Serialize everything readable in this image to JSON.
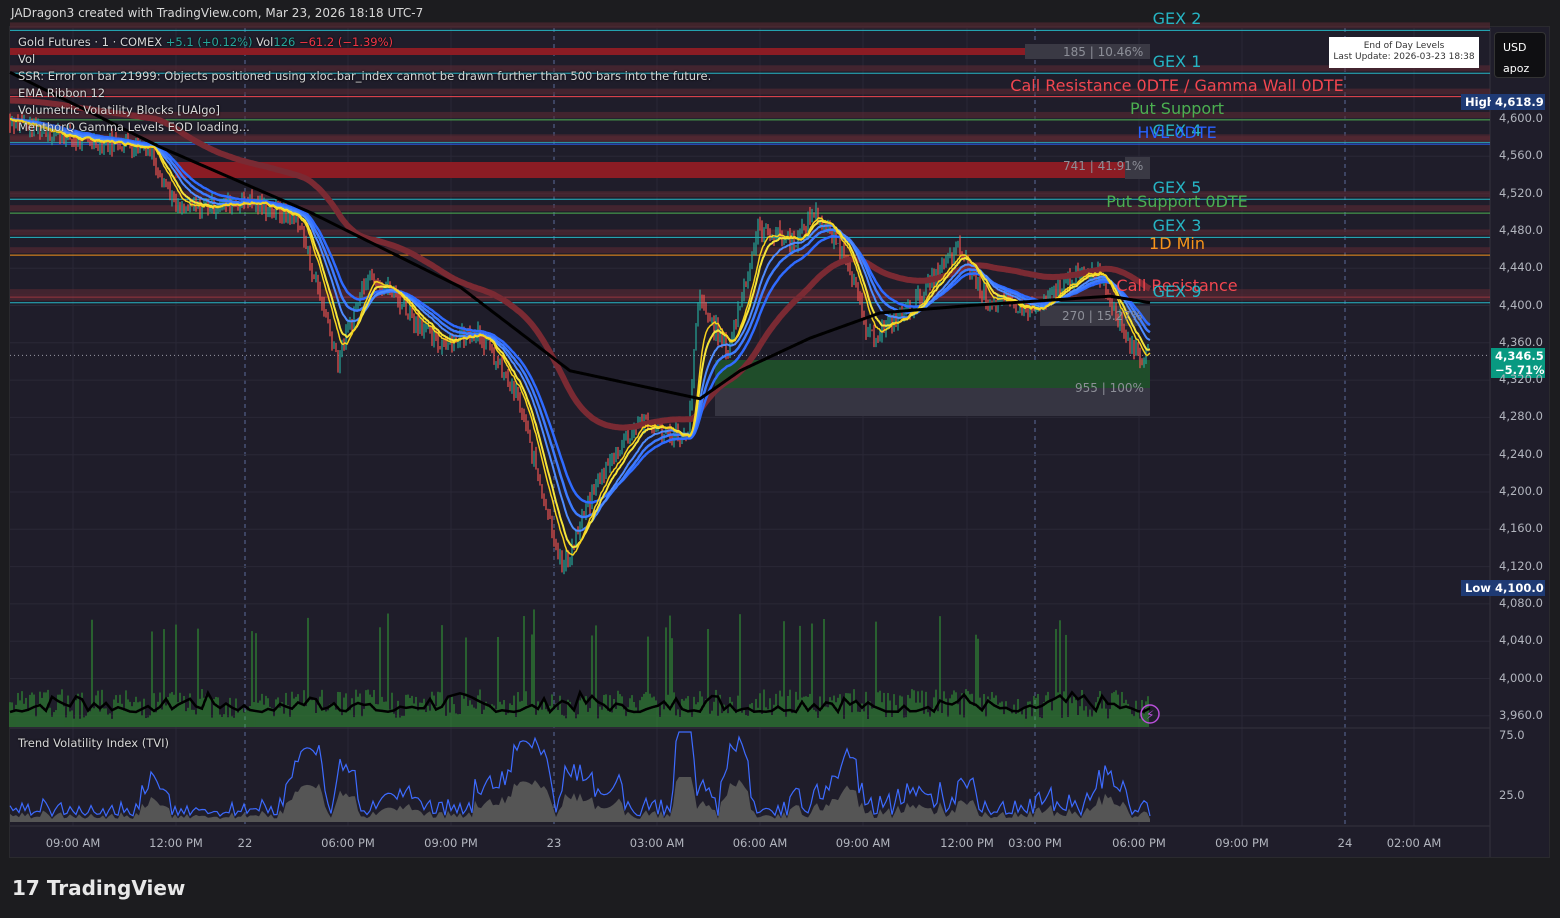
{
  "header": {
    "attribution": "JADragon3 created with TradingView.com, Mar 23, 2026 18:18 UTC-7"
  },
  "legend": {
    "symbol": "Gold Futures · 1 · COMEX",
    "change": "+5.1 (+0.12%)",
    "vol_label": "Vol",
    "vol_value": "126",
    "vol_change": "−61.2 (−1.39%)",
    "items": [
      "Vol",
      "SSR: Error on bar 21999: Objects positioned using xloc.bar_index cannot be drawn further than 500 bars into the future.",
      "EMA Ribbon 12",
      "Volumetric Volatility Blocks [UAlgo]",
      "MenthorQ Gamma Levels EOD loading..."
    ]
  },
  "eod_box": {
    "title": "End of Day Levels",
    "updated": "Last Update: 2026-03-23 18:38"
  },
  "currency": {
    "currency": "USD",
    "user": "apoz"
  },
  "price_axis": {
    "ticks": [
      4600,
      4560,
      4520,
      4480,
      4440,
      4400,
      4360,
      4320,
      4280,
      4240,
      4200,
      4160,
      4120,
      4080,
      4040,
      4000,
      3960
    ],
    "labels": [
      "4,600.0",
      "4,560.0",
      "4,520.0",
      "4,480.0",
      "4,440.0",
      "4,400.0",
      "4,360.0",
      "4,320.0",
      "4,280.0",
      "4,240.0",
      "4,200.0",
      "4,160.0",
      "4,120.0",
      "4,080.0",
      "4,040.0",
      "4,000.0",
      "3,960.0"
    ],
    "high_label": "High",
    "high_value": "4,618.9",
    "low_label": "Low",
    "low_value": "4,100.0",
    "last_price": "4,346.5",
    "last_change": "−5.71%"
  },
  "tvi": {
    "title": "Trend Volatility Index (TVI)",
    "ticks": [
      "75.0",
      "25.0"
    ]
  },
  "time_axis": [
    "09:00 AM",
    "12:00 PM",
    "22",
    "06:00 PM",
    "09:00 PM",
    "23",
    "03:00 AM",
    "06:00 AM",
    "09:00 AM",
    "12:00 PM",
    "03:00 PM",
    "06:00 PM",
    "09:00 PM",
    "24",
    "02:00 AM"
  ],
  "levels": [
    {
      "label": "GEX 2",
      "price": 4695,
      "color": "#26b5c4"
    },
    {
      "label": "GEX 1",
      "price": 4649,
      "color": "#26b5c4"
    },
    {
      "label": "Call Resistance 0DTE / Gamma Wall 0DTE",
      "price": 4624,
      "color": "#f2464f"
    },
    {
      "label": "Put Support",
      "price": 4599,
      "color": "#4caf50"
    },
    {
      "label": "GEX 4",
      "price": 4575,
      "color": "#26b5c4"
    },
    {
      "label": "HVL 0DTE",
      "price": 4573,
      "color": "#2962ff"
    },
    {
      "label": "GEX 5",
      "price": 4514,
      "color": "#26b5c4"
    },
    {
      "label": "Put Support 0DTE",
      "price": 4499,
      "color": "#4caf50"
    },
    {
      "label": "GEX 3",
      "price": 4473,
      "color": "#26b5c4"
    },
    {
      "label": "1D Min",
      "price": 4454,
      "color": "#f7931a"
    },
    {
      "label": "Call Resistance",
      "price": 4409,
      "color": "#f2464f"
    },
    {
      "label": "GEX 9",
      "price": 4403,
      "color": "#26b5c4"
    }
  ],
  "blocks": [
    {
      "label": "185 | 10.46%"
    },
    {
      "label": "741 | 41.91%"
    },
    {
      "label": "270 | 15.27%"
    },
    {
      "label": "955 | 100%"
    }
  ],
  "chart_data": {
    "type": "line",
    "title": "Gold Futures · 1 · COMEX",
    "ylim": [
      3950,
      4700
    ],
    "price_path": {
      "bar": [
        0,
        70,
        140,
        170,
        240,
        290,
        330,
        360,
        390,
        430,
        470,
        510,
        555,
        590,
        630,
        680,
        690,
        720,
        750,
        790,
        805,
        840,
        860,
        900,
        950,
        980,
        1030,
        1060,
        1090,
        1120,
        1135,
        1140
      ],
      "price": [
        4600,
        4577,
        4572,
        4502,
        4513,
        4492,
        4342,
        4438,
        4406,
        4358,
        4374,
        4299,
        4116,
        4213,
        4277,
        4256,
        4406,
        4352,
        4481,
        4470,
        4502,
        4449,
        4363,
        4395,
        4460,
        4406,
        4395,
        4427,
        4438,
        4363,
        4342,
        4346.5
      ]
    },
    "slow_ema": {
      "bar": [
        0,
        150,
        300,
        450,
        560,
        690,
        730,
        800,
        870,
        960,
        1100,
        1140
      ],
      "price": [
        4650,
        4570,
        4500,
        4420,
        4330,
        4300,
        4330,
        4365,
        4392,
        4400,
        4410,
        4403
      ]
    }
  },
  "footer": {
    "brand": "TradingView"
  }
}
